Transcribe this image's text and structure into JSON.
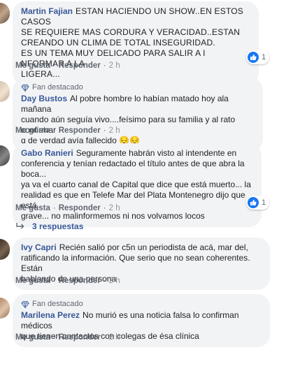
{
  "colors": {
    "link": "#385898",
    "bubble": "#f2f3f5",
    "meta": "#606770",
    "like": "#1877f2"
  },
  "comments": [
    {
      "author": "Martin Fajian",
      "text_lines": [
        "ESTAN HACIENDO UN SHOW..EN ESTOS CASOS",
        "SE REQUIERE MAS CORDURA Y VERACIDAD..ESTAN",
        "CREANDO UN CLIMA DE TOTAL INSEGURIDAD.",
        "ES UN TEMA MUY DELICADO PARA SALIR A I NFORMAR A LA",
        "LIGERA..."
      ],
      "like_label": "Me gusta",
      "reply_label": "Responder",
      "time": "2 h",
      "reaction_icon": "like-icon",
      "reaction_count": "1"
    },
    {
      "badge": "Fan destacado",
      "badge_icon": "diamond-badge-icon",
      "author": "Day Bustos",
      "text_lines": [
        "Al pobre hombre lo habían matado hoy ala mañana",
        "cuando aún seguía vivo....feísimo para su familia y al rato confirmar",
        "q de verdad avía fallecido 😔😔"
      ],
      "like_label": "Me gusta",
      "reply_label": "Responder",
      "time": "2 h"
    },
    {
      "author": "Gabo Ranieri",
      "text_lines": [
        "Seguramente habrán visto al intendente en",
        "conferencia y tenían redactado el título antes de que abra la boca...",
        "ya va el cuarto canal de Capital que dice que está muerto... la",
        "realidad es que en Telefe Mar del Plata Montenegro dijo que está",
        "grave... no malinformemos ni nos volvamos locos"
      ],
      "like_label": "Me gusta",
      "reply_label": "Responder",
      "time": "2 h",
      "reaction_icon": "like-icon",
      "reaction_count": "1",
      "replies_label": "3 respuestas",
      "replies_icon": "reply-arrow-icon"
    },
    {
      "author": "Ivy Capri",
      "text_lines": [
        "Recién salió por c5n un periodista de acá, mar del,",
        "ratificando la información. Que serio que no sean coherentes. Están",
        "hablando de una persona"
      ],
      "like_label": "Me gusta",
      "reply_label": "Responder",
      "time": "2 h"
    },
    {
      "badge": "Fan destacado",
      "badge_icon": "diamond-badge-icon",
      "author": "Marilena Perez",
      "text_lines": [
        "No murió es una noticia falsa lo confirman médicos",
        "que tienen contactos con colegas de ésa clínica"
      ],
      "like_label": "Me gusta",
      "reply_label": "Responder",
      "time": "2 h"
    }
  ]
}
